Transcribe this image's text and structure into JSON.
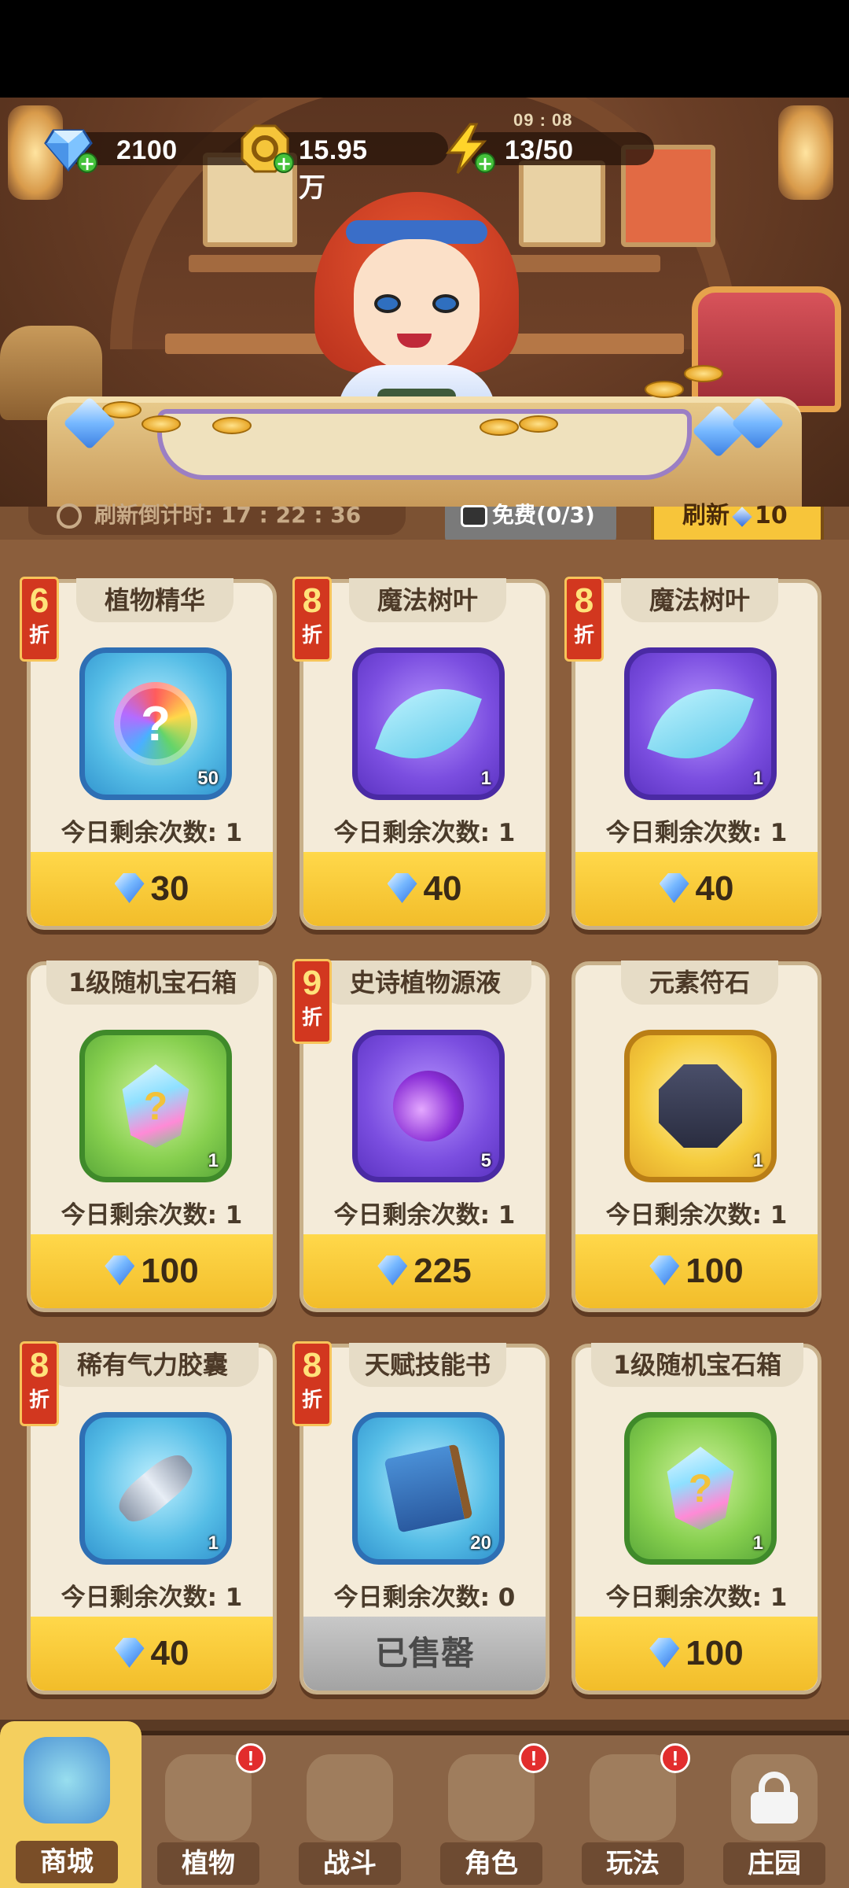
{
  "resources": {
    "gems": "2100",
    "gold": "15.95万",
    "energy": "13/50",
    "energy_timer": "09 : 08"
  },
  "shop_bar": {
    "refresh_countdown": "刷新倒计时: 17 : 22 : 36",
    "free_label": "免费(0/3)",
    "refresh_label": "刷新",
    "refresh_cost": "10"
  },
  "items": [
    {
      "name": "植物精华",
      "discount": "6",
      "discount_unit": "折",
      "qty": "50",
      "remaining": "今日剩余次数: 1",
      "price": "30",
      "box": "blue",
      "pic": "seed",
      "icon": "rainbow-seed-icon"
    },
    {
      "name": "魔法树叶",
      "discount": "8",
      "discount_unit": "折",
      "qty": "1",
      "remaining": "今日剩余次数: 1",
      "price": "40",
      "box": "purple",
      "pic": "leaf",
      "icon": "magic-leaf-icon"
    },
    {
      "name": "魔法树叶",
      "discount": "8",
      "discount_unit": "折",
      "qty": "1",
      "remaining": "今日剩余次数: 1",
      "price": "40",
      "box": "purple",
      "pic": "leaf",
      "icon": "magic-leaf-icon"
    },
    {
      "name": "1级随机宝石箱",
      "discount": "",
      "discount_unit": "",
      "qty": "1",
      "remaining": "今日剩余次数: 1",
      "price": "100",
      "box": "green",
      "pic": "crystal",
      "icon": "random-gem-crystal-icon"
    },
    {
      "name": "史诗植物源液",
      "discount": "9",
      "discount_unit": "折",
      "qty": "5",
      "remaining": "今日剩余次数: 1",
      "price": "225",
      "box": "purple",
      "pic": "potion",
      "icon": "plant-potion-icon"
    },
    {
      "name": "元素符石",
      "discount": "",
      "discount_unit": "",
      "qty": "1",
      "remaining": "今日剩余次数: 1",
      "price": "100",
      "box": "gold",
      "pic": "rune",
      "icon": "rune-stone-icon"
    },
    {
      "name": "稀有气力胶囊",
      "discount": "8",
      "discount_unit": "折",
      "qty": "1",
      "remaining": "今日剩余次数: 1",
      "price": "40",
      "box": "blue",
      "pic": "capsule",
      "icon": "stamina-capsule-icon"
    },
    {
      "name": "天赋技能书",
      "discount": "8",
      "discount_unit": "折",
      "qty": "20",
      "remaining": "今日剩余次数: 0",
      "price": "已售罄",
      "sold_out": true,
      "box": "blue",
      "pic": "book",
      "icon": "skill-book-icon"
    },
    {
      "name": "1级随机宝石箱",
      "discount": "",
      "discount_unit": "",
      "qty": "1",
      "remaining": "今日剩余次数: 1",
      "price": "100",
      "box": "green",
      "pic": "crystal",
      "icon": "random-gem-crystal-icon"
    }
  ],
  "nav": [
    {
      "label": "商城",
      "active": true,
      "badge": "",
      "icon": "shop-icon"
    },
    {
      "label": "植物",
      "active": false,
      "badge": "!",
      "icon": "plant-icon"
    },
    {
      "label": "战斗",
      "active": false,
      "badge": "",
      "icon": "battle-icon"
    },
    {
      "label": "角色",
      "active": false,
      "badge": "!",
      "icon": "character-icon"
    },
    {
      "label": "玩法",
      "active": false,
      "badge": "!",
      "icon": "gameplay-icon"
    },
    {
      "label": "庄园",
      "active": false,
      "badge": "",
      "icon": "lock-icon"
    }
  ],
  "colors": {
    "price_bar": "#f7c53a",
    "discount_tag": "#d2371f",
    "card_bg": "#f4ebd9",
    "board_bg": "#8b5e3c"
  }
}
